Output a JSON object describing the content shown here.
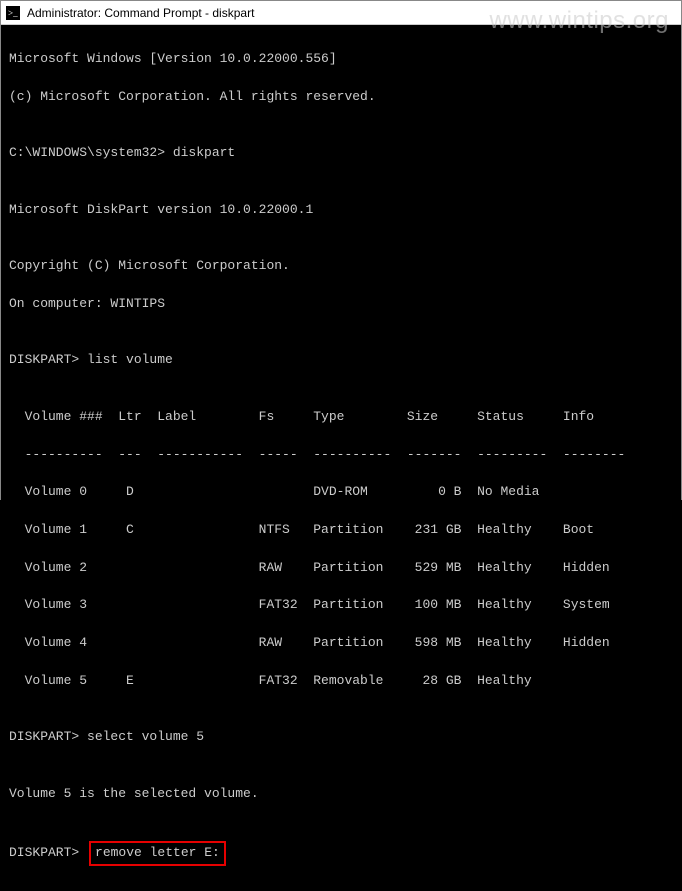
{
  "window": {
    "title": "Administrator: Command Prompt - diskpart"
  },
  "watermark": "www.wintips.org",
  "lines": {
    "l0": "Microsoft Windows [Version 10.0.22000.556]",
    "l1": "(c) Microsoft Corporation. All rights reserved.",
    "l2": "",
    "l3": "C:\\WINDOWS\\system32> diskpart",
    "l4": "",
    "l5": "Microsoft DiskPart version 10.0.22000.1",
    "l6": "",
    "l7": "Copyright (C) Microsoft Corporation.",
    "l8": "On computer: WINTIPS",
    "l9": "",
    "p1_prompt": "DISKPART> ",
    "p1_cmd": "list volume",
    "l11": "",
    "thead": "  Volume ###  Ltr  Label        Fs     Type        Size     Status     Info",
    "tsep": "  ----------  ---  -----------  -----  ----------  -------  ---------  --------",
    "v0": "  Volume 0     D                       DVD-ROM         0 B  No Media",
    "v1": "  Volume 1     C                NTFS   Partition    231 GB  Healthy    Boot",
    "v2": "  Volume 2                      RAW    Partition    529 MB  Healthy    Hidden",
    "v3": "  Volume 3                      FAT32  Partition    100 MB  Healthy    System",
    "v4": "  Volume 4                      RAW    Partition    598 MB  Healthy    Hidden",
    "v5": "  Volume 5     E                FAT32  Removable     28 GB  Healthy",
    "l19": "",
    "p2_prompt": "DISKPART> ",
    "p2_cmd": "select volume 5",
    "l21": "",
    "l22": "Volume 5 is the selected volume.",
    "l23": "",
    "p3_prompt": "DISKPART> ",
    "p3_cmd": "remove letter E:"
  },
  "chart_data": {
    "type": "table",
    "title": "list volume",
    "columns": [
      "Volume ###",
      "Ltr",
      "Label",
      "Fs",
      "Type",
      "Size",
      "Status",
      "Info"
    ],
    "rows": [
      {
        "Volume ###": "Volume 0",
        "Ltr": "D",
        "Label": "",
        "Fs": "",
        "Type": "DVD-ROM",
        "Size": "0 B",
        "Status": "No Media",
        "Info": ""
      },
      {
        "Volume ###": "Volume 1",
        "Ltr": "C",
        "Label": "",
        "Fs": "NTFS",
        "Type": "Partition",
        "Size": "231 GB",
        "Status": "Healthy",
        "Info": "Boot"
      },
      {
        "Volume ###": "Volume 2",
        "Ltr": "",
        "Label": "",
        "Fs": "RAW",
        "Type": "Partition",
        "Size": "529 MB",
        "Status": "Healthy",
        "Info": "Hidden"
      },
      {
        "Volume ###": "Volume 3",
        "Ltr": "",
        "Label": "",
        "Fs": "FAT32",
        "Type": "Partition",
        "Size": "100 MB",
        "Status": "Healthy",
        "Info": "System"
      },
      {
        "Volume ###": "Volume 4",
        "Ltr": "",
        "Label": "",
        "Fs": "RAW",
        "Type": "Partition",
        "Size": "598 MB",
        "Status": "Healthy",
        "Info": "Hidden"
      },
      {
        "Volume ###": "Volume 5",
        "Ltr": "E",
        "Label": "",
        "Fs": "FAT32",
        "Type": "Removable",
        "Size": "28 GB",
        "Status": "Healthy",
        "Info": ""
      }
    ]
  }
}
